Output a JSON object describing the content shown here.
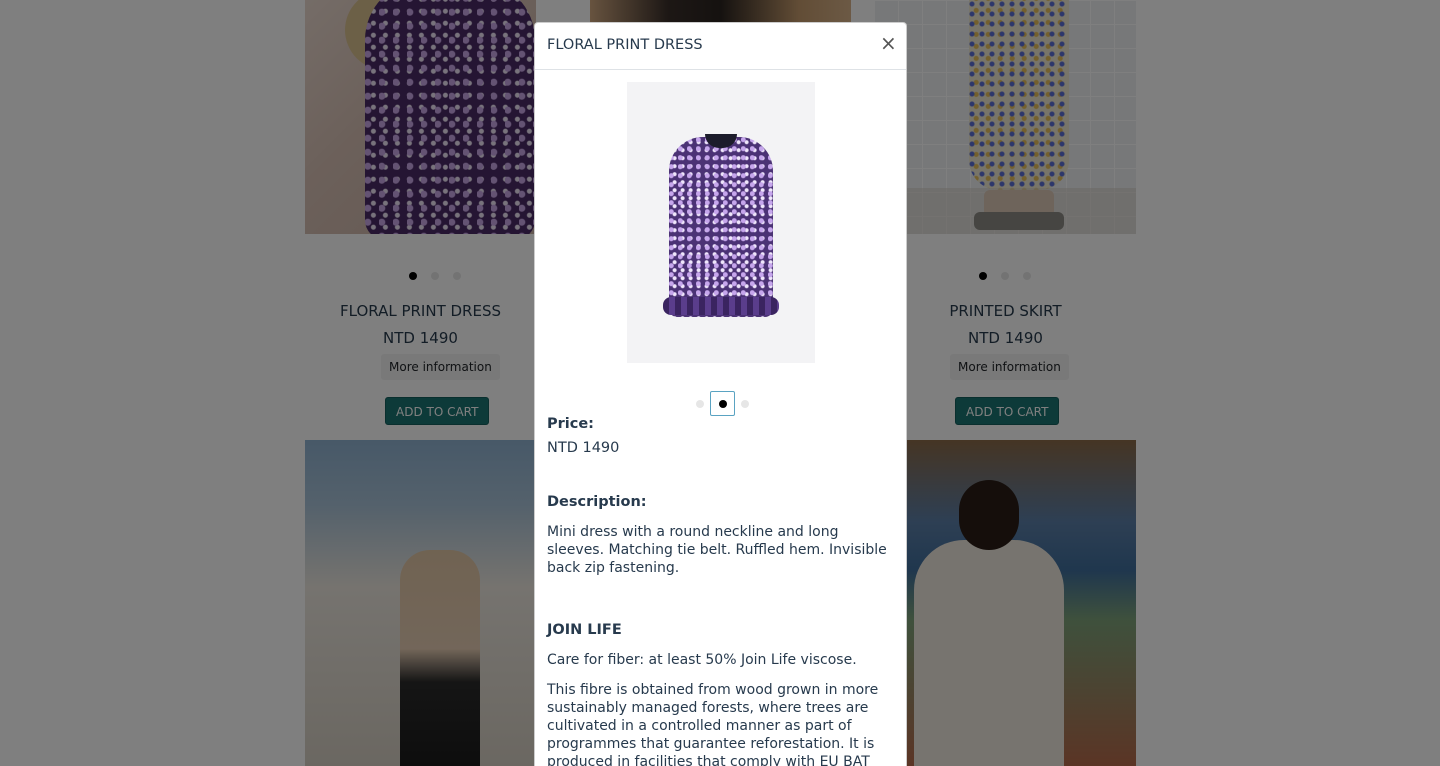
{
  "grid": {
    "cards": [
      {
        "title": "FLORAL PRINT DRESS",
        "price": "NTD 1490",
        "info_label": "More information",
        "cart_label": "ADD TO CART"
      },
      {
        "title": "PRINTED SKIRT",
        "price": "NTD 1490",
        "info_label": "More information",
        "cart_label": "ADD TO CART"
      }
    ]
  },
  "modal": {
    "title": "FLORAL PRINT DRESS",
    "close_glyph": "×",
    "price_label": "Price:",
    "price_value": "NTD 1490",
    "description_label": "Description:",
    "description": "Mini dress with a round neckline and long sleeves. Matching tie belt. Ruffled hem. Invisible back zip fastening.",
    "section_title": "JOIN LIFE",
    "care_text": "Care for fiber: at least 50% Join Life viscose.",
    "fibre_text": "This fibre is obtained from wood grown in more sustainably managed forests, where trees are cultivated in a controlled manner as part of programmes that guarantee reforestation. It is produced in facilities that comply with EU BAT"
  },
  "colors": {
    "overlay": "rgba(0,0,0,0.5)",
    "accent": "#1a7472",
    "text": "#273a4d"
  }
}
